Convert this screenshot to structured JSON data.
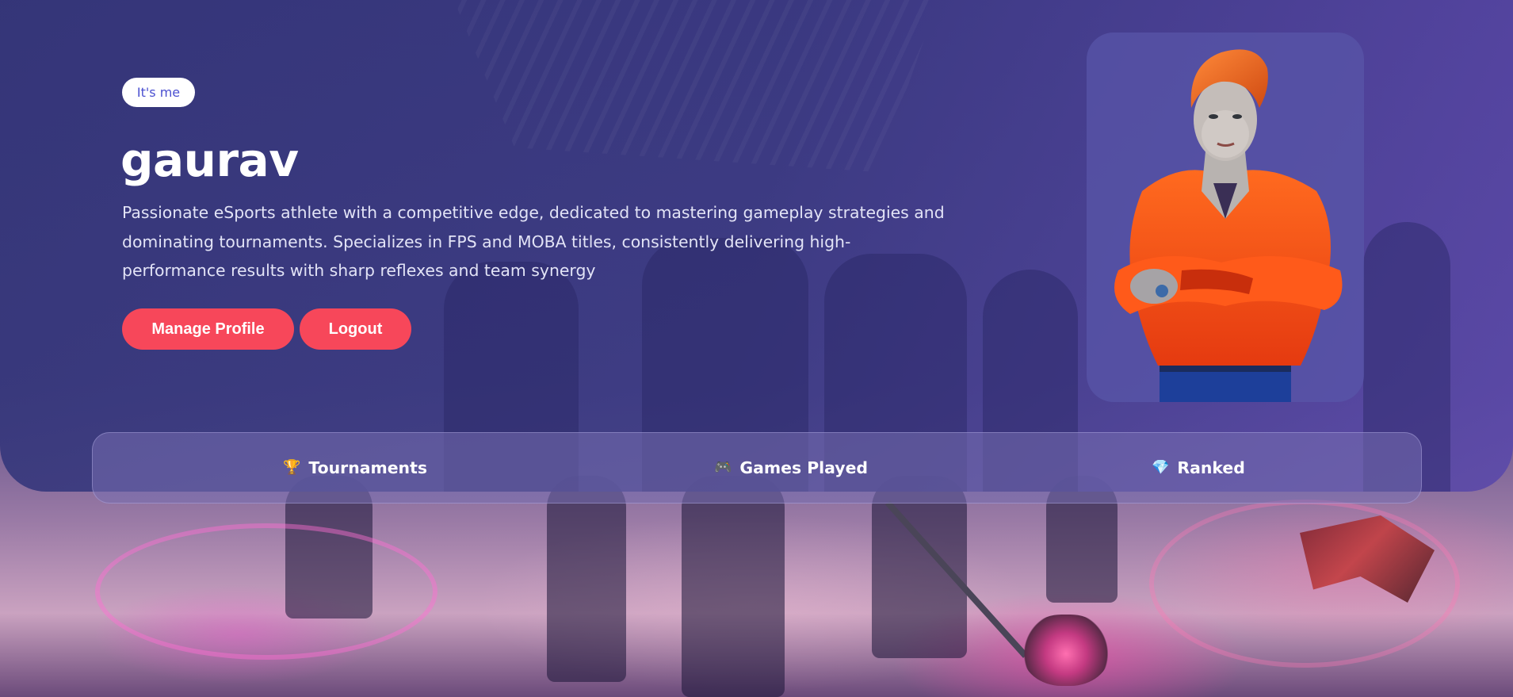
{
  "profile": {
    "badge": "It's me",
    "name": "gaurav",
    "bio": "Passionate eSports athlete with a competitive edge, dedicated to mastering gameplay strategies and dominating tournaments. Specializes in FPS and MOBA titles, consistently delivering high-performance results with sharp reflexes and team synergy",
    "avatar_icon": "player-avatar"
  },
  "actions": {
    "manage_label": "Manage Profile",
    "logout_label": "Logout"
  },
  "stats": [
    {
      "icon": "trophy-icon",
      "glyph": "🏆",
      "label": "Tournaments"
    },
    {
      "icon": "gamepad-icon",
      "glyph": "🎮",
      "label": "Games Played"
    },
    {
      "icon": "gem-icon",
      "glyph": "💎",
      "label": "Ranked"
    }
  ],
  "colors": {
    "accent": "#f7475a",
    "hero": "#3a3a84",
    "badge_text": "#4a4fd0"
  }
}
